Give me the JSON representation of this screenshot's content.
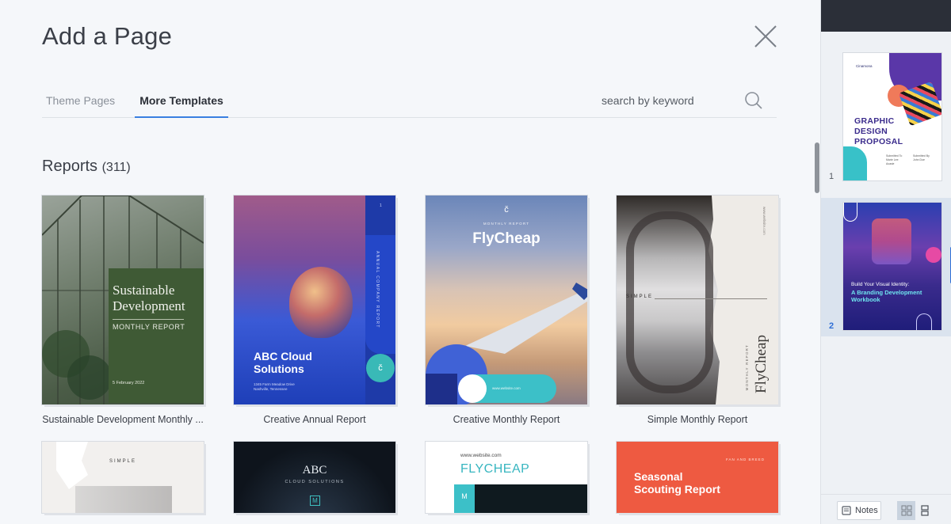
{
  "modal": {
    "title": "Add a Page",
    "tabs": [
      {
        "label": "Theme Pages"
      },
      {
        "label": "More Templates"
      }
    ],
    "search": {
      "placeholder": "search by keyword"
    },
    "section": {
      "title": "Reports",
      "count": "(311)"
    }
  },
  "templates": [
    {
      "label": "Sustainable Development Monthly ...",
      "title": "Sustainable Development",
      "subtitle": "MONTHLY REPORT",
      "date": "5 February 2022"
    },
    {
      "label": "Creative Annual Report",
      "title": "ABC Cloud Solutions",
      "address": "1345 Farm Meadow Drive\nNashville, Tennessee",
      "vertical": "ANNUAL COMPANY REPORT",
      "page": "1",
      "logo": "č"
    },
    {
      "label": "Creative Monthly Report",
      "logo": "č",
      "small": "MONTHLY REPORT",
      "title": "FlyCheap",
      "web": "www.website.com"
    },
    {
      "label": "Simple Monthly Report",
      "simple": "SIMPLE",
      "vtitle": "FlyCheap",
      "vsub": "MONTHLY REPORT",
      "vweb": "www.website.com"
    },
    {
      "simple": "SIMPLE"
    },
    {
      "title": "ABC",
      "subtitle": "CLOUD SOLUTIONS",
      "mark": "M"
    },
    {
      "web": "www.website.com",
      "title": "FLYCHEAP",
      "mark": "M"
    },
    {
      "title": "Seasonal Scouting Report",
      "brand": "FAN AND BREED"
    }
  ],
  "sidebar": {
    "pages": [
      {
        "number": "1",
        "logo": "Cinamona",
        "title": "GRAPHIC DESIGN PROPOSAL",
        "meta1": "Submitted To\nMarie Lee\nAcasie",
        "meta2": "Submitted By\nJohn Doe"
      },
      {
        "number": "2",
        "small": "Build Your Visual Identity:",
        "title": "A Branding Development Workbook"
      }
    ],
    "notes_label": "Notes"
  },
  "colors": {
    "accent": "#3a7fe0",
    "text": "#3b3f48",
    "muted": "#8a9099"
  }
}
